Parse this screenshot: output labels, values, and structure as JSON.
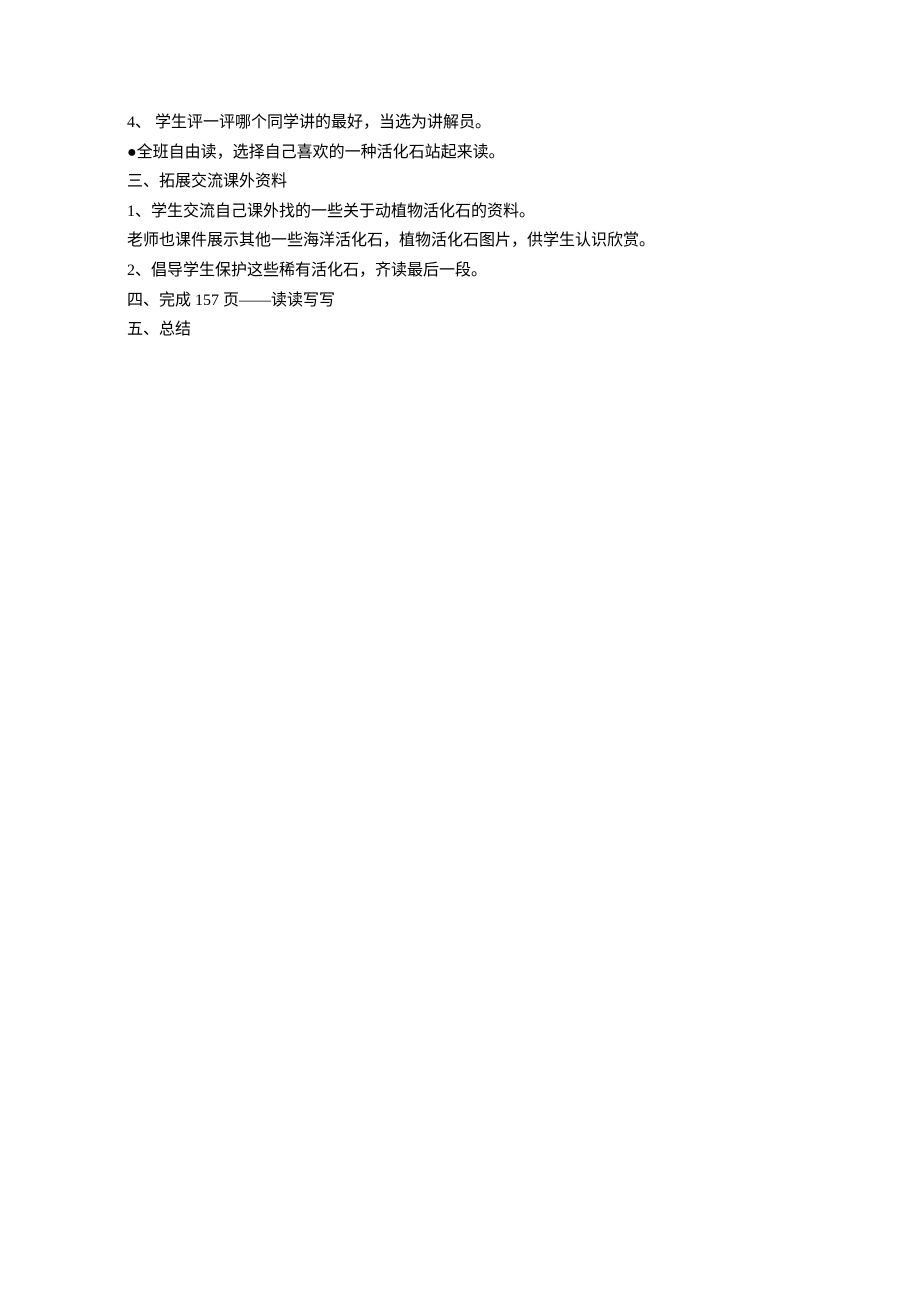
{
  "lines": [
    "4、 学生评一评哪个同学讲的最好，当选为讲解员。",
    "●全班自由读，选择自己喜欢的一种活化石站起来读。",
    "三、拓展交流课外资料",
    "1、学生交流自己课外找的一些关于动植物活化石的资料。",
    "老师也课件展示其他一些海洋活化石，植物活化石图片，供学生认识欣赏。",
    "2、倡导学生保护这些稀有活化石，齐读最后一段。",
    "四、完成 157 页——读读写写",
    "五、总结"
  ]
}
